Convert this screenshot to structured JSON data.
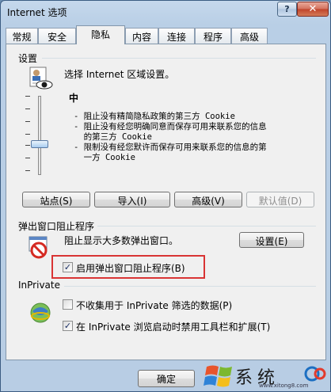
{
  "window": {
    "title": "Internet 选项"
  },
  "titlebar": {
    "help_label": "?",
    "close_label": "✕"
  },
  "tabs": [
    {
      "label": "常规"
    },
    {
      "label": "安全"
    },
    {
      "label": "隐私"
    },
    {
      "label": "内容"
    },
    {
      "label": "连接"
    },
    {
      "label": "程序"
    },
    {
      "label": "高级"
    }
  ],
  "settings": {
    "group_title": "设置",
    "zone_text": "选择 Internet 区域设置。",
    "level": "中",
    "descriptions": [
      "- 阻止没有精简隐私政策的第三方 Cookie",
      "- 阻止没有经您明确同意而保存可用来联系您的信息的第三方 Cookie",
      "- 限制没有经您默许而保存可用来联系您的信息的第一方 Cookie"
    ],
    "desc_lines": [
      "- 阻止没有精简隐私政策的第三方 Cookie",
      "- 阻止没有经您明确同意而保存可用来联系您的信息",
      "  的第三方 Cookie",
      "- 限制没有经您默许而保存可用来联系您的信息的第",
      "  一方 Cookie"
    ],
    "buttons": {
      "sites": "站点(S)",
      "import": "导入(I)",
      "advanced": "高级(V)",
      "default": "默认值(D)"
    }
  },
  "popup": {
    "group_title": "弹出窗口阻止程序",
    "text": "阻止显示大多数弹出窗口。",
    "settings_button": "设置(E)",
    "enable_label": "启用弹出窗口阻止程序(B)",
    "enable_checked": true
  },
  "inprivate": {
    "group_title": "InPrivate",
    "option1_label": "不收集用于 InPrivate 筛选的数据(P)",
    "option1_checked": false,
    "option2_label": "在 InPrivate 浏览启动时禁用工具栏和扩展(T)",
    "option2_checked": true
  },
  "footer": {
    "ok_label": "确定",
    "watermark_text": "系统",
    "watermark_url": "www.xitong8.com"
  }
}
